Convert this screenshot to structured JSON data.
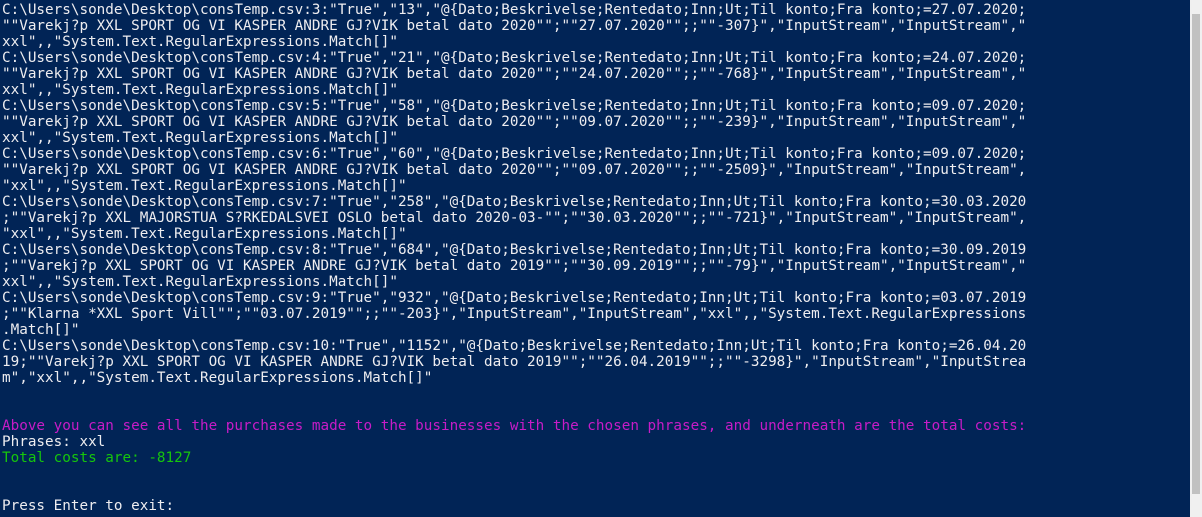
{
  "console": {
    "lines": [
      {
        "text": "C:\\Users\\sonde\\Desktop\\consTemp.csv:3:\"True\",\"13\",\"@{Dato;Beskrivelse;Rentedato;Inn;Ut;Til konto;Fra konto;=27.07.2020;",
        "color": "default"
      },
      {
        "text": "\"\"Varekj?p XXL SPORT OG VI KASPER ANDRE GJ?VIK betal dato 2020\"\";\"\"27.07.2020\"\";;\"\"-307}\",\"InputStream\",\"InputStream\",\"",
        "color": "default"
      },
      {
        "text": "xxl\",,\"System.Text.RegularExpressions.Match[]\"",
        "color": "default"
      },
      {
        "text": "C:\\Users\\sonde\\Desktop\\consTemp.csv:4:\"True\",\"21\",\"@{Dato;Beskrivelse;Rentedato;Inn;Ut;Til konto;Fra konto;=24.07.2020;",
        "color": "default"
      },
      {
        "text": "\"\"Varekj?p XXL SPORT OG VI KASPER ANDRE GJ?VIK betal dato 2020\"\";\"\"24.07.2020\"\";;\"\"-768}\",\"InputStream\",\"InputStream\",\"",
        "color": "default"
      },
      {
        "text": "xxl\",,\"System.Text.RegularExpressions.Match[]\"",
        "color": "default"
      },
      {
        "text": "C:\\Users\\sonde\\Desktop\\consTemp.csv:5:\"True\",\"58\",\"@{Dato;Beskrivelse;Rentedato;Inn;Ut;Til konto;Fra konto;=09.07.2020;",
        "color": "default"
      },
      {
        "text": "\"\"Varekj?p XXL SPORT OG VI KASPER ANDRE GJ?VIK betal dato 2020\"\";\"\"09.07.2020\"\";;\"\"-239}\",\"InputStream\",\"InputStream\",\"",
        "color": "default"
      },
      {
        "text": "xxl\",,\"System.Text.RegularExpressions.Match[]\"",
        "color": "default"
      },
      {
        "text": "C:\\Users\\sonde\\Desktop\\consTemp.csv:6:\"True\",\"60\",\"@{Dato;Beskrivelse;Rentedato;Inn;Ut;Til konto;Fra konto;=09.07.2020;",
        "color": "default"
      },
      {
        "text": "\"\"Varekj?p XXL SPORT OG VI KASPER ANDRE GJ?VIK betal dato 2020\"\";\"\"09.07.2020\"\";;\"\"-2509}\",\"InputStream\",\"InputStream\",",
        "color": "default"
      },
      {
        "text": "\"xxl\",,\"System.Text.RegularExpressions.Match[]\"",
        "color": "default"
      },
      {
        "text": "C:\\Users\\sonde\\Desktop\\consTemp.csv:7:\"True\",\"258\",\"@{Dato;Beskrivelse;Rentedato;Inn;Ut;Til konto;Fra konto;=30.03.2020",
        "color": "default"
      },
      {
        "text": ";\"\"Varekj?p XXL MAJORSTUA S?RKEDALSVEI OSLO betal dato 2020-03-\"\";\"\"30.03.2020\"\";;\"\"-721}\",\"InputStream\",\"InputStream\",",
        "color": "default"
      },
      {
        "text": "\"xxl\",,\"System.Text.RegularExpressions.Match[]\"",
        "color": "default"
      },
      {
        "text": "C:\\Users\\sonde\\Desktop\\consTemp.csv:8:\"True\",\"684\",\"@{Dato;Beskrivelse;Rentedato;Inn;Ut;Til konto;Fra konto;=30.09.2019",
        "color": "default"
      },
      {
        "text": ";\"\"Varekj?p XXL SPORT OG VI KASPER ANDRE GJ?VIK betal dato 2019\"\";\"\"30.09.2019\"\";;\"\"-79}\",\"InputStream\",\"InputStream\",\"",
        "color": "default"
      },
      {
        "text": "xxl\",,\"System.Text.RegularExpressions.Match[]\"",
        "color": "default"
      },
      {
        "text": "C:\\Users\\sonde\\Desktop\\consTemp.csv:9:\"True\",\"932\",\"@{Dato;Beskrivelse;Rentedato;Inn;Ut;Til konto;Fra konto;=03.07.2019",
        "color": "default"
      },
      {
        "text": ";\"\"Klarna *XXL Sport Vill\"\";\"\"03.07.2019\"\";;\"\"-203}\",\"InputStream\",\"InputStream\",\"xxl\",,\"System.Text.RegularExpressions",
        "color": "default"
      },
      {
        "text": ".Match[]\"",
        "color": "default"
      },
      {
        "text": "C:\\Users\\sonde\\Desktop\\consTemp.csv:10:\"True\",\"1152\",\"@{Dato;Beskrivelse;Rentedato;Inn;Ut;Til konto;Fra konto;=26.04.20",
        "color": "default"
      },
      {
        "text": "19;\"\"Varekj?p XXL SPORT OG VI KASPER ANDRE GJ?VIK betal dato 2019\"\";\"\"26.04.2019\"\";;\"\"-3298}\",\"InputStream\",\"InputStrea",
        "color": "default"
      },
      {
        "text": "m\",\"xxl\",,\"System.Text.RegularExpressions.Match[]\"",
        "color": "default"
      },
      {
        "text": "",
        "color": "default"
      },
      {
        "text": "",
        "color": "default"
      },
      {
        "text": "Above you can see all the purchases made to the businesses with the chosen phrases, and underneath are the total costs:",
        "color": "magenta"
      },
      {
        "text": "Phrases: xxl",
        "color": "default"
      },
      {
        "text": "Total costs are: -8127",
        "color": "green"
      },
      {
        "text": "",
        "color": "default"
      },
      {
        "text": "",
        "color": "default"
      },
      {
        "text": "Press Enter to exit:",
        "color": "default"
      }
    ]
  },
  "colors": {
    "background": "#012456",
    "text": "#eeedf0",
    "magenta": "#c71cc7",
    "green": "#16c60c"
  }
}
